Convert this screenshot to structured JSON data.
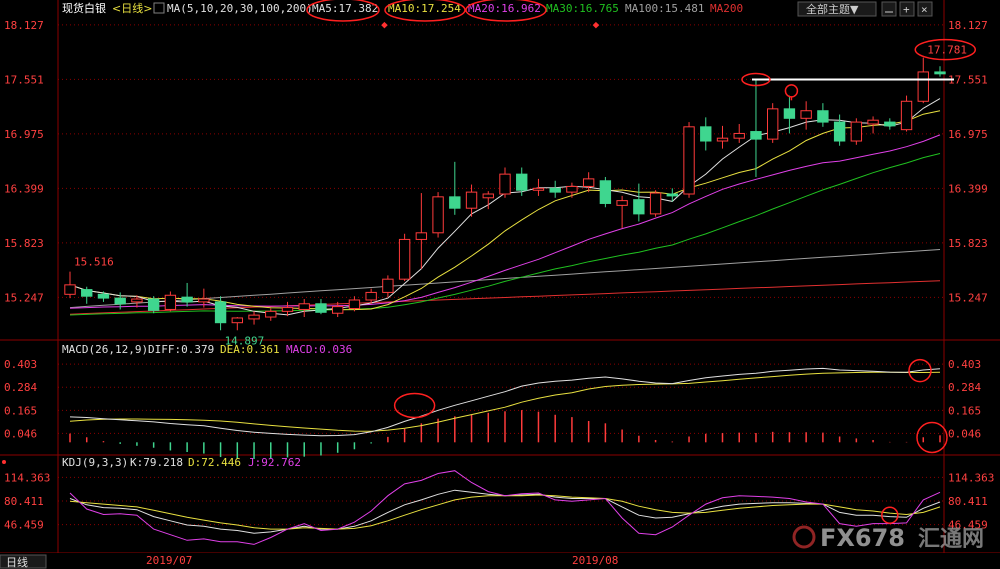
{
  "header": {
    "symbol": "现货白银",
    "period_tag": "<日线>",
    "ma_label": "MA(5,10,20,30,100,200)",
    "ma5": "MA5:17.382",
    "ma10": "MA10:17.254",
    "ma20": "MA20:16.962",
    "ma30": "MA30:16.765",
    "ma100": "MA100:15.481",
    "ma200": "MA200",
    "theme_button": "全部主题▼"
  },
  "macd_header": {
    "label": "MACD(26,12,9)",
    "diff": "DIFF:0.379",
    "dea": "DEA:0.361",
    "macd": "MACD:0.036"
  },
  "kdj_header": {
    "label": "KDJ(9,3,3)",
    "k": "K:79.218",
    "d": "D:72.446",
    "j": "J:92.762"
  },
  "footer": {
    "period": "日线",
    "month1": "2019/07",
    "month2": "2019/08",
    "watermark": "FX678",
    "watermark_cn": "汇通网"
  },
  "colors": {
    "up": "#ff3b3b",
    "down": "#3fd68f",
    "ma5": "#e0e0e0",
    "ma10": "#e8e040",
    "ma20": "#e040e8",
    "ma30": "#20c020",
    "ma100": "#a0a0a0",
    "ma200": "#e03030",
    "axis_text": "#ff4040",
    "grid": "#8b0000"
  },
  "chart_data": [
    {
      "type": "candlestick",
      "title": "现货白银",
      "ylim": [
        14.85,
        18.2
      ],
      "yticks": [
        18.127,
        17.551,
        16.975,
        16.399,
        15.823,
        15.247
      ],
      "annotations": {
        "high_label": "17.781",
        "swing_high_label": "15.516",
        "swing_low_label": "14.897",
        "resistance_level": 17.55
      },
      "candles": [
        {
          "o": 15.28,
          "h": 15.52,
          "l": 15.24,
          "c": 15.38
        },
        {
          "o": 15.33,
          "h": 15.36,
          "l": 15.18,
          "c": 15.26
        },
        {
          "o": 15.28,
          "h": 15.31,
          "l": 15.2,
          "c": 15.24
        },
        {
          "o": 15.24,
          "h": 15.3,
          "l": 15.12,
          "c": 15.18
        },
        {
          "o": 15.2,
          "h": 15.27,
          "l": 15.14,
          "c": 15.23
        },
        {
          "o": 15.23,
          "h": 15.26,
          "l": 15.08,
          "c": 15.11
        },
        {
          "o": 15.12,
          "h": 15.31,
          "l": 15.1,
          "c": 15.27
        },
        {
          "o": 15.25,
          "h": 15.4,
          "l": 15.15,
          "c": 15.2
        },
        {
          "o": 15.2,
          "h": 15.34,
          "l": 15.14,
          "c": 15.23
        },
        {
          "o": 15.2,
          "h": 15.26,
          "l": 14.9,
          "c": 14.98
        },
        {
          "o": 14.98,
          "h": 15.04,
          "l": 14.9,
          "c": 15.03
        },
        {
          "o": 15.02,
          "h": 15.1,
          "l": 14.96,
          "c": 15.06
        },
        {
          "o": 15.04,
          "h": 15.13,
          "l": 15.0,
          "c": 15.1
        },
        {
          "o": 15.1,
          "h": 15.2,
          "l": 15.05,
          "c": 15.14
        },
        {
          "o": 15.12,
          "h": 15.23,
          "l": 15.04,
          "c": 15.18
        },
        {
          "o": 15.18,
          "h": 15.23,
          "l": 15.07,
          "c": 15.09
        },
        {
          "o": 15.08,
          "h": 15.2,
          "l": 15.04,
          "c": 15.15
        },
        {
          "o": 15.13,
          "h": 15.26,
          "l": 15.1,
          "c": 15.22
        },
        {
          "o": 15.22,
          "h": 15.34,
          "l": 15.18,
          "c": 15.3
        },
        {
          "o": 15.3,
          "h": 15.48,
          "l": 15.25,
          "c": 15.44
        },
        {
          "o": 15.44,
          "h": 15.92,
          "l": 15.42,
          "c": 15.86
        },
        {
          "o": 15.86,
          "h": 16.35,
          "l": 15.55,
          "c": 15.93
        },
        {
          "o": 15.93,
          "h": 16.36,
          "l": 15.88,
          "c": 16.31
        },
        {
          "o": 16.31,
          "h": 16.68,
          "l": 16.12,
          "c": 16.19
        },
        {
          "o": 16.19,
          "h": 16.44,
          "l": 16.1,
          "c": 16.36
        },
        {
          "o": 16.3,
          "h": 16.37,
          "l": 16.18,
          "c": 16.34
        },
        {
          "o": 16.34,
          "h": 16.62,
          "l": 16.3,
          "c": 16.55
        },
        {
          "o": 16.55,
          "h": 16.62,
          "l": 16.32,
          "c": 16.38
        },
        {
          "o": 16.38,
          "h": 16.5,
          "l": 16.32,
          "c": 16.4
        },
        {
          "o": 16.4,
          "h": 16.48,
          "l": 16.3,
          "c": 16.36
        },
        {
          "o": 16.36,
          "h": 16.46,
          "l": 16.3,
          "c": 16.42
        },
        {
          "o": 16.42,
          "h": 16.57,
          "l": 16.36,
          "c": 16.5
        },
        {
          "o": 16.48,
          "h": 16.52,
          "l": 16.2,
          "c": 16.24
        },
        {
          "o": 16.22,
          "h": 16.32,
          "l": 15.98,
          "c": 16.27
        },
        {
          "o": 16.28,
          "h": 16.45,
          "l": 16.05,
          "c": 16.13
        },
        {
          "o": 16.13,
          "h": 16.38,
          "l": 16.1,
          "c": 16.35
        },
        {
          "o": 16.34,
          "h": 16.4,
          "l": 16.26,
          "c": 16.32
        },
        {
          "o": 16.34,
          "h": 17.1,
          "l": 16.3,
          "c": 17.05
        },
        {
          "o": 17.05,
          "h": 17.15,
          "l": 16.8,
          "c": 16.9
        },
        {
          "o": 16.9,
          "h": 17.06,
          "l": 16.82,
          "c": 16.93
        },
        {
          "o": 16.93,
          "h": 17.08,
          "l": 16.88,
          "c": 16.98
        },
        {
          "o": 17.0,
          "h": 17.55,
          "l": 16.52,
          "c": 16.92
        },
        {
          "o": 16.92,
          "h": 17.3,
          "l": 16.88,
          "c": 17.24
        },
        {
          "o": 17.24,
          "h": 17.38,
          "l": 16.98,
          "c": 17.14
        },
        {
          "o": 17.14,
          "h": 17.32,
          "l": 17.02,
          "c": 17.22
        },
        {
          "o": 17.22,
          "h": 17.3,
          "l": 17.05,
          "c": 17.1
        },
        {
          "o": 17.1,
          "h": 17.18,
          "l": 16.85,
          "c": 16.9
        },
        {
          "o": 16.9,
          "h": 17.14,
          "l": 16.86,
          "c": 17.1
        },
        {
          "o": 17.08,
          "h": 17.16,
          "l": 16.98,
          "c": 17.12
        },
        {
          "o": 17.1,
          "h": 17.14,
          "l": 17.02,
          "c": 17.06
        },
        {
          "o": 17.02,
          "h": 17.38,
          "l": 17.0,
          "c": 17.32
        },
        {
          "o": 17.32,
          "h": 17.781,
          "l": 17.3,
          "c": 17.63
        },
        {
          "o": 17.63,
          "h": 17.69,
          "l": 17.58,
          "c": 17.61
        }
      ]
    },
    {
      "type": "line",
      "title": "MACD(26,12,9)",
      "ylim": [
        -0.05,
        0.44
      ],
      "yticks": [
        0.403,
        0.284,
        0.165,
        0.046
      ],
      "series": [
        {
          "name": "DIFF",
          "values": [
            0.131,
            0.128,
            0.122,
            0.116,
            0.111,
            0.105,
            0.097,
            0.091,
            0.085,
            0.072,
            0.061,
            0.052,
            0.046,
            0.041,
            0.037,
            0.034,
            0.035,
            0.04,
            0.054,
            0.077,
            0.108,
            0.135,
            0.165,
            0.191,
            0.214,
            0.238,
            0.261,
            0.29,
            0.306,
            0.315,
            0.321,
            0.33,
            0.337,
            0.327,
            0.315,
            0.306,
            0.303,
            0.319,
            0.333,
            0.342,
            0.35,
            0.356,
            0.366,
            0.372,
            0.378,
            0.381,
            0.373,
            0.37,
            0.367,
            0.362,
            0.361,
            0.373,
            0.379
          ]
        },
        {
          "name": "DEA",
          "values": [
            0.109,
            0.115,
            0.119,
            0.12,
            0.12,
            0.119,
            0.118,
            0.116,
            0.114,
            0.11,
            0.103,
            0.095,
            0.087,
            0.08,
            0.074,
            0.068,
            0.062,
            0.058,
            0.057,
            0.063,
            0.073,
            0.086,
            0.104,
            0.124,
            0.143,
            0.162,
            0.181,
            0.207,
            0.227,
            0.244,
            0.256,
            0.275,
            0.288,
            0.294,
            0.298,
            0.3,
            0.301,
            0.304,
            0.311,
            0.318,
            0.325,
            0.332,
            0.339,
            0.346,
            0.352,
            0.356,
            0.358,
            0.36,
            0.361,
            0.361,
            0.36,
            0.36,
            0.361
          ]
        },
        {
          "name": "MACD",
          "values": [
            0.045,
            0.026,
            0.006,
            -0.008,
            -0.018,
            -0.028,
            -0.042,
            -0.05,
            -0.058,
            -0.076,
            -0.084,
            -0.086,
            -0.082,
            -0.078,
            -0.074,
            -0.068,
            -0.054,
            -0.036,
            -0.006,
            0.028,
            0.07,
            0.098,
            0.122,
            0.134,
            0.142,
            0.152,
            0.16,
            0.166,
            0.158,
            0.142,
            0.13,
            0.11,
            0.098,
            0.066,
            0.034,
            0.012,
            0.004,
            0.03,
            0.044,
            0.048,
            0.05,
            0.048,
            0.054,
            0.052,
            0.052,
            0.05,
            0.03,
            0.02,
            0.012,
            0.002,
            0.002,
            0.026,
            0.036
          ]
        }
      ]
    },
    {
      "type": "line",
      "title": "KDJ(9,3,3)",
      "ylim": [
        10,
        125
      ],
      "yticks": [
        114.363,
        80.411,
        46.459
      ],
      "series": [
        {
          "name": "K",
          "values": [
            84,
            75,
            71,
            70,
            68,
            58,
            52,
            46,
            44,
            40,
            38,
            34,
            36,
            40,
            44,
            40,
            40,
            44,
            52,
            64,
            75,
            82,
            90,
            96,
            93,
            90,
            88,
            89,
            90,
            86,
            84,
            84,
            84,
            72,
            60,
            56,
            57,
            62,
            68,
            73,
            76,
            77,
            78,
            78,
            77,
            76,
            64,
            60,
            60,
            58,
            57,
            70,
            79
          ]
        },
        {
          "name": "D",
          "values": [
            80,
            78,
            76,
            74,
            72,
            67,
            62,
            57,
            53,
            49,
            46,
            42,
            40,
            40,
            42,
            41,
            40,
            41,
            45,
            52,
            60,
            68,
            75,
            82,
            86,
            88,
            88,
            88,
            89,
            88,
            86,
            85,
            84,
            80,
            73,
            68,
            64,
            63,
            64,
            67,
            70,
            72,
            74,
            75,
            76,
            76,
            72,
            68,
            66,
            63,
            61,
            64,
            72
          ]
        },
        {
          "name": "J",
          "values": [
            92,
            69,
            61,
            62,
            60,
            40,
            32,
            24,
            26,
            22,
            22,
            18,
            28,
            40,
            48,
            38,
            40,
            50,
            66,
            88,
            105,
            110,
            120,
            124,
            107,
            94,
            88,
            91,
            92,
            82,
            80,
            82,
            84,
            56,
            34,
            32,
            43,
            60,
            76,
            85,
            88,
            87,
            86,
            84,
            79,
            76,
            48,
            44,
            48,
            48,
            49,
            82,
            93
          ]
        }
      ]
    }
  ]
}
